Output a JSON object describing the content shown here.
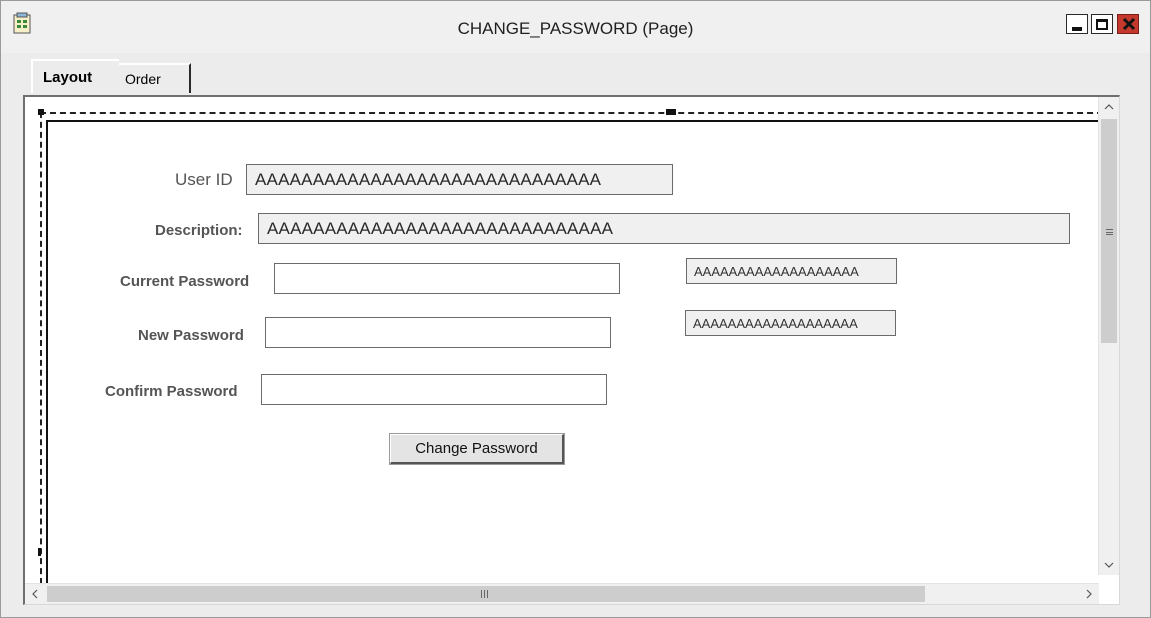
{
  "window": {
    "title": "CHANGE_PASSWORD (Page)",
    "icon": "page-definition-icon",
    "controls": [
      "minimize-icon",
      "maximize-icon",
      "close-icon"
    ],
    "close_color": "#c4392d"
  },
  "tabs": [
    {
      "label": "Layout",
      "active": true
    },
    {
      "label": "Order",
      "active": false
    }
  ],
  "form": {
    "user_id_label": "User ID",
    "user_id_value": "AAAAAAAAAAAAAAAAAAAAAAAAAAAAAA",
    "description_label": "Description:",
    "description_value": "AAAAAAAAAAAAAAAAAAAAAAAAAAAAAA",
    "current_password_label": "Current Password",
    "current_password_value": "",
    "current_password_side_value": "AAAAAAAAAAAAAAAAAAA",
    "new_password_label": "New Password",
    "new_password_value": "",
    "new_password_side_value": "AAAAAAAAAAAAAAAAAAA",
    "confirm_password_label": "Confirm Password",
    "confirm_password_value": "",
    "change_password_button": "Change Password"
  },
  "scrollbars": {
    "vertical_icons": [
      "chevron-up-icon",
      "chevron-down-icon"
    ],
    "horizontal_icons": [
      "chevron-left-icon",
      "chevron-right-icon"
    ]
  }
}
